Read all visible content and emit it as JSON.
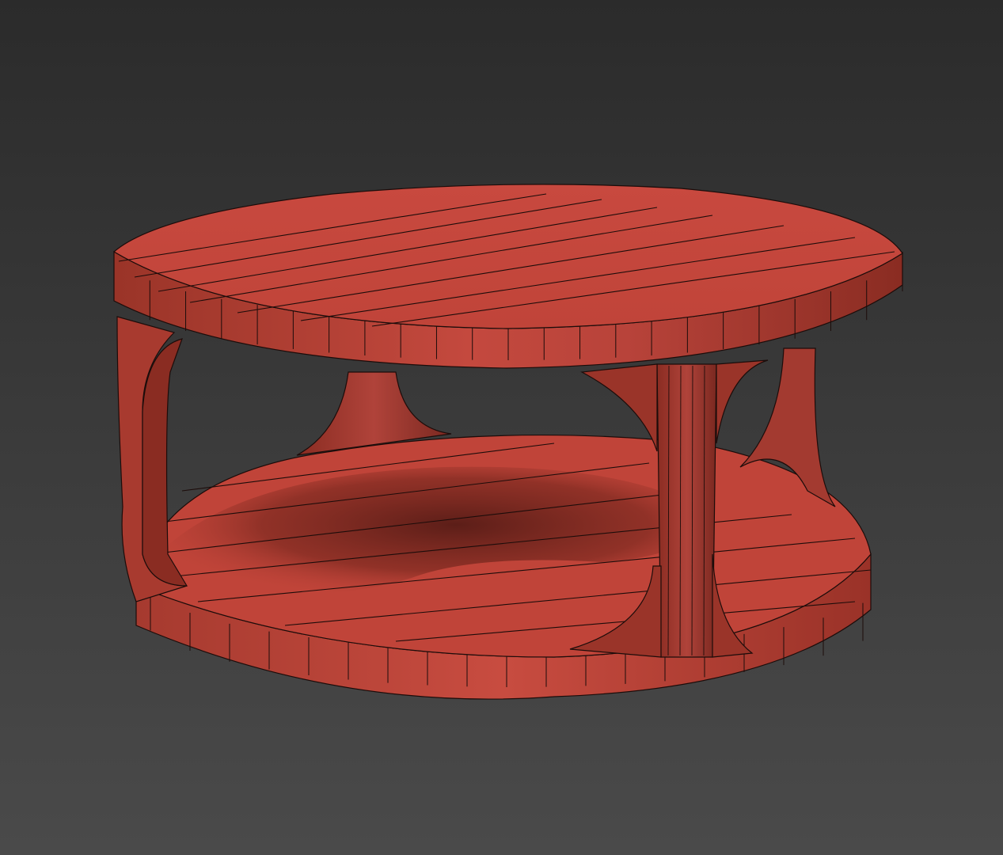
{
  "viewport": {
    "background_top": "#2b2b2b",
    "background_bottom": "#4a4a4a"
  },
  "model": {
    "name": "",
    "base_color": "#c0473c",
    "light_color": "#cc5246",
    "dark_color": "#7a2820",
    "shadow_color": "#5a1f18",
    "wire_color": "#1c0c0a"
  }
}
